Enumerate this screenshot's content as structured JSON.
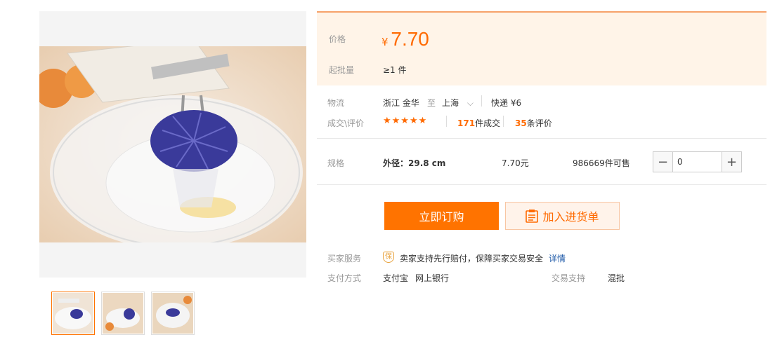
{
  "price_box": {
    "price_label": "价格",
    "currency": "¥",
    "price": "7.70",
    "moq_label": "起批量",
    "moq_value": "≥1 件"
  },
  "logistics": {
    "label": "物流",
    "from": "浙江 金华",
    "to_word": "至",
    "to": "上海",
    "shipping": "快递 ¥6"
  },
  "reviews": {
    "label": "成交\\评价",
    "stars": "★★★★★",
    "deals_count": "171",
    "deals_text": "件成交",
    "review_count": "35",
    "review_text": "条评价"
  },
  "spec": {
    "label": "规格",
    "name": "外径：29.8 cm",
    "unit_price": "7.70元",
    "stock": "986669件可售",
    "quantity": "0",
    "minus": "−",
    "plus": "+"
  },
  "actions": {
    "buy_label": "立即订购",
    "cart_label": "加入进货单"
  },
  "services": {
    "buyer_label": "买家服务",
    "shield_glyph": "保",
    "buyer_text": "卖家支持先行赔付，保障买家交易安全",
    "detail_link": "详情",
    "pay_label": "支付方式",
    "pay_1": "支付宝",
    "pay_2": "网上银行",
    "trade_label": "交易支持",
    "trade_value": "混批"
  },
  "colors": {
    "accent": "#ff7300",
    "price": "#ff6a00",
    "product_blue": "#3a3a9a"
  }
}
